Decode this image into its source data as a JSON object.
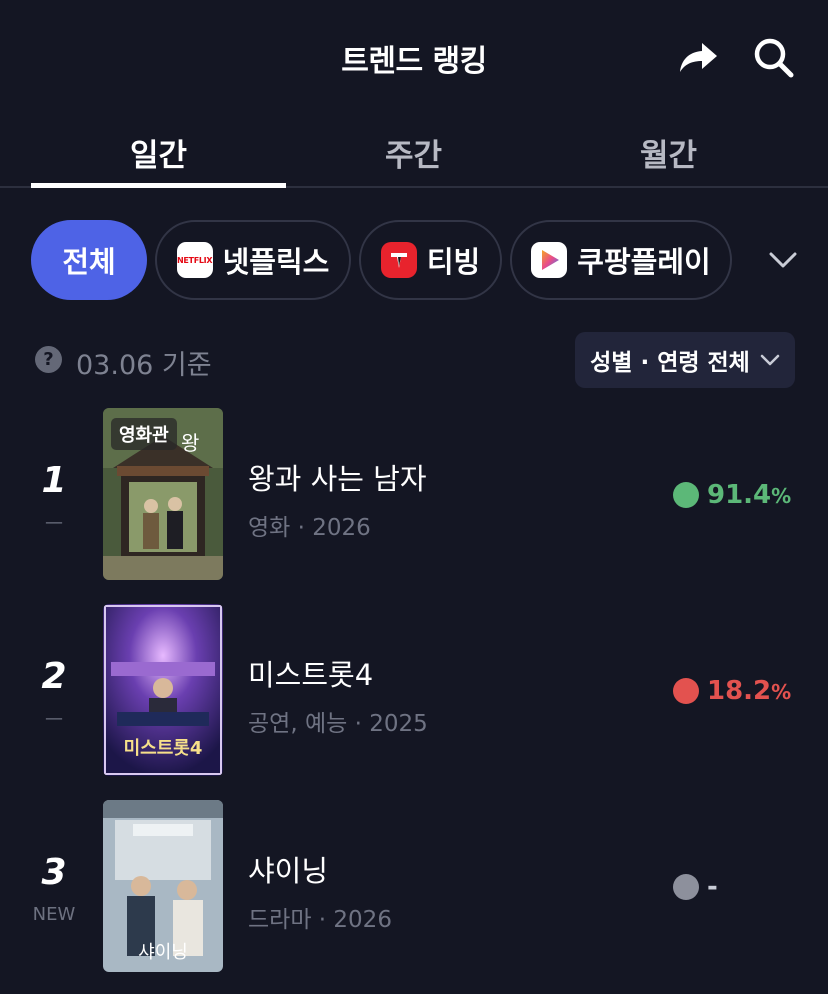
{
  "header": {
    "title": "트렌드 랭킹",
    "share_icon": "share-arrow-icon",
    "search_icon": "search-icon"
  },
  "tabs": [
    {
      "label": "일간",
      "active": true
    },
    {
      "label": "주간",
      "active": false
    },
    {
      "label": "월간",
      "active": false
    }
  ],
  "filters": {
    "all_label": "전체",
    "netflix": {
      "label": "넷플릭스",
      "logo_text": "NETFLIX"
    },
    "tving": {
      "label": "티빙"
    },
    "coupang": {
      "label": "쿠팡플레이"
    },
    "expand_icon": "chevron-down-icon"
  },
  "info": {
    "help_icon_text": "?",
    "date_label": "03.06 기준",
    "demographic_filter": "성별 · 연령 전체"
  },
  "rankings": [
    {
      "rank": "1",
      "change": "—",
      "badge": "영화관",
      "title": "왕과 사는 남자",
      "meta": "영화 · 2026",
      "score_value": "91.4",
      "score_unit": "%",
      "score_color": "#5cb878",
      "dot_color": "#5cb878"
    },
    {
      "rank": "2",
      "change": "—",
      "badge": "",
      "title": "미스트롯4",
      "meta": "공연, 예능 · 2025",
      "score_value": "18.2",
      "score_unit": "%",
      "score_color": "#e3524f",
      "dot_color": "#e3524f"
    },
    {
      "rank": "3",
      "change": "NEW",
      "badge": "",
      "title": "샤이닝",
      "meta": "드라마 · 2026",
      "score_value": "-",
      "score_unit": "",
      "score_color": "#c9ccd6",
      "dot_color": "#8d909c"
    }
  ],
  "colors": {
    "background": "#141623",
    "accent": "#4e63e6",
    "positive": "#5cb878",
    "negative": "#e3524f"
  }
}
